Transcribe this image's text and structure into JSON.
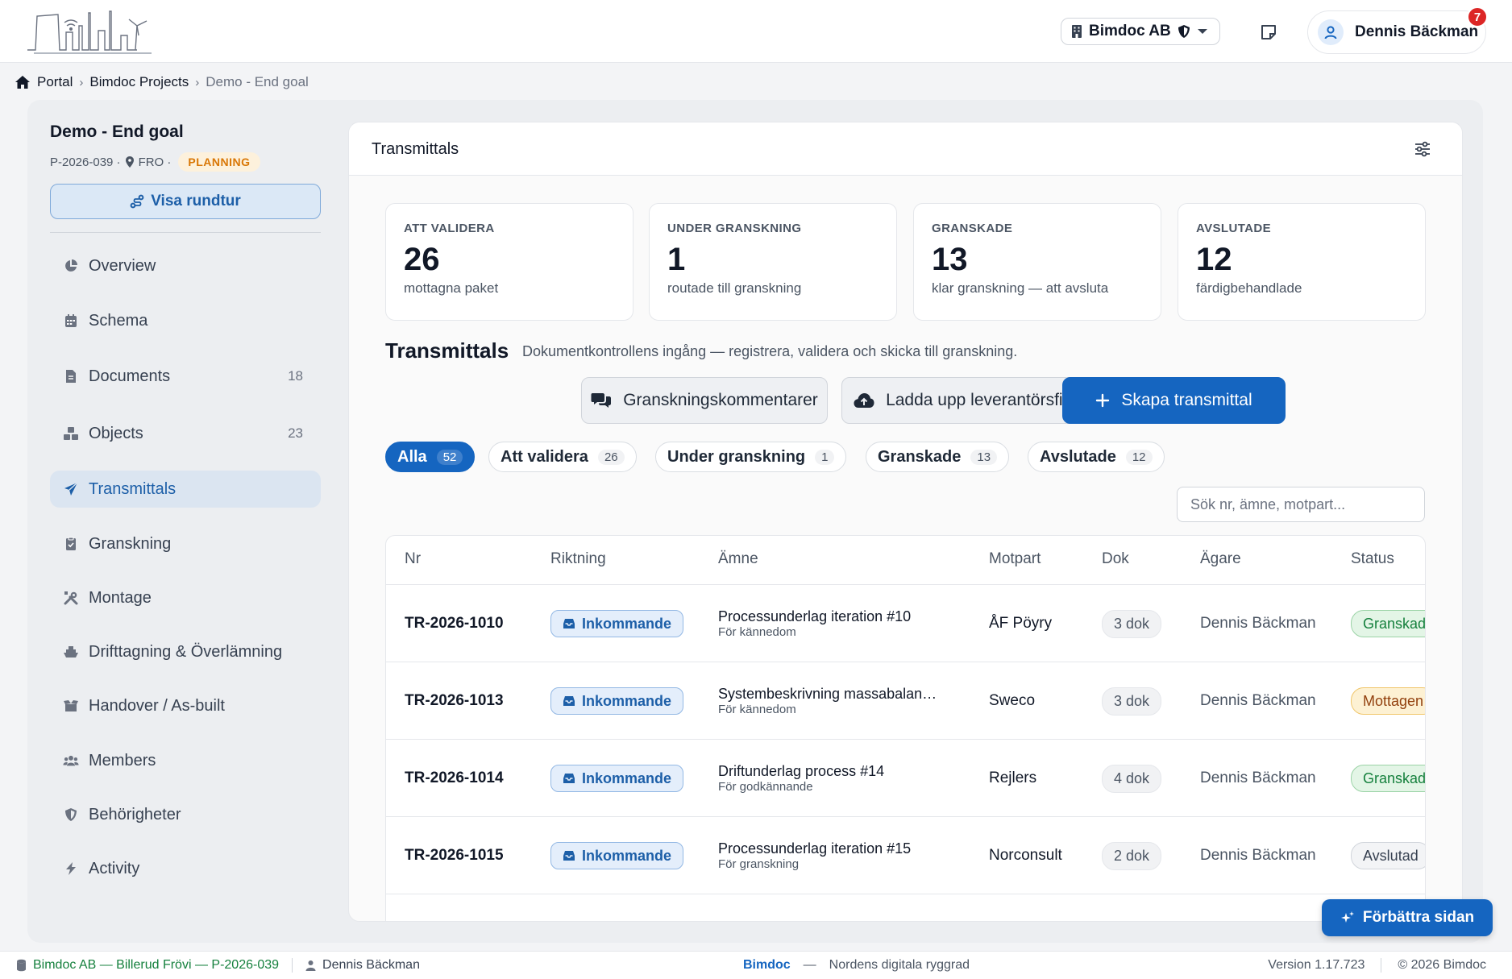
{
  "colors": {
    "primary": "#1565c0",
    "planning_badge": "#d97706",
    "footer_project": "#15803d",
    "notification": "#dc2626"
  },
  "header": {
    "logo_icon": "city-skyline-logo",
    "company": "Bimdoc AB",
    "user_name": "Dennis Bäckman",
    "notification_count": "7"
  },
  "breadcrumb": {
    "items": [
      "Portal",
      "Bimdoc Projects"
    ],
    "current": "Demo - End goal"
  },
  "project": {
    "title": "Demo - End goal",
    "code": "P-2026-039 ·",
    "location": "FRO ·",
    "phase": "PLANNING",
    "tour_button": "Visa rundtur"
  },
  "sidebar": {
    "items": [
      {
        "label": "Overview",
        "icon": "chart-pie-icon",
        "count": ""
      },
      {
        "label": "Schema",
        "icon": "calendar-icon",
        "count": ""
      },
      {
        "label": "Documents",
        "icon": "file-icon",
        "count": "18"
      },
      {
        "label": "Objects",
        "icon": "cubes-icon",
        "count": "23"
      },
      {
        "label": "Transmittals",
        "icon": "paper-plane-icon",
        "count": ""
      },
      {
        "label": "Granskning",
        "icon": "clipboard-check-icon",
        "count": ""
      },
      {
        "label": "Montage",
        "icon": "tools-icon",
        "count": ""
      },
      {
        "label": "Drifttagning & Överlämning",
        "icon": "ship-icon",
        "count": ""
      },
      {
        "label": "Handover / As-built",
        "icon": "box-open-icon",
        "count": ""
      },
      {
        "label": "Members",
        "icon": "users-icon",
        "count": ""
      },
      {
        "label": "Behörigheter",
        "icon": "shield-icon",
        "count": ""
      },
      {
        "label": "Activity",
        "icon": "bolt-icon",
        "count": ""
      }
    ],
    "active_index": 4
  },
  "main": {
    "panel_title": "Transmittals",
    "stats": [
      {
        "label": "ATT VALIDERA",
        "value": "26",
        "desc": "mottagna paket"
      },
      {
        "label": "UNDER GRANSKNING",
        "value": "1",
        "desc": "routade till granskning"
      },
      {
        "label": "GRANSKADE",
        "value": "13",
        "desc": "klar granskning — att avsluta"
      },
      {
        "label": "AVSLUTADE",
        "value": "12",
        "desc": "färdigbehandlade"
      }
    ],
    "section_title": "Transmittals",
    "section_desc": "Dokumentkontrollens ingång — registrera, validera och skicka till granskning.",
    "buttons": {
      "comments": "Granskningskommentarer",
      "upload": "Ladda upp leverantörsfiler",
      "create": "Skapa transmittal"
    },
    "filters": [
      {
        "label": "Alla",
        "count": "52"
      },
      {
        "label": "Att validera",
        "count": "26"
      },
      {
        "label": "Under granskning",
        "count": "1"
      },
      {
        "label": "Granskade",
        "count": "13"
      },
      {
        "label": "Avslutade",
        "count": "12"
      }
    ],
    "search_placeholder": "Sök nr, ämne, motpart...",
    "table": {
      "columns": [
        "Nr",
        "Riktning",
        "Ämne",
        "Motpart",
        "Dok",
        "Ägare",
        "Status"
      ],
      "rows": [
        {
          "nr": "TR-2026-1010",
          "direction": "Inkommande",
          "subject": "Processunderlag iteration #10",
          "purpose": "För kännedom",
          "party": "ÅF Pöyry",
          "docs": "3 dok",
          "owner": "Dennis Bäckman",
          "status": "Granskad"
        },
        {
          "nr": "TR-2026-1013",
          "direction": "Inkommande",
          "subject": "Systembeskrivning massabalan…",
          "purpose": "För kännedom",
          "party": "Sweco",
          "docs": "3 dok",
          "owner": "Dennis Bäckman",
          "status": "Mottagen"
        },
        {
          "nr": "TR-2026-1014",
          "direction": "Inkommande",
          "subject": "Driftunderlag process #14",
          "purpose": "För godkännande",
          "party": "Rejlers",
          "docs": "4 dok",
          "owner": "Dennis Bäckman",
          "status": "Granskad"
        },
        {
          "nr": "TR-2026-1015",
          "direction": "Inkommande",
          "subject": "Processunderlag iteration #15",
          "purpose": "För granskning",
          "party": "Norconsult",
          "docs": "2 dok",
          "owner": "Dennis Bäckman",
          "status": "Avslutad"
        }
      ]
    }
  },
  "improve_button": "Förbättra sidan",
  "footer": {
    "project": "Bimdoc AB — Billerud Frövi — P-2026-039",
    "user": "Dennis Bäckman",
    "brand": "Bimdoc",
    "dash": "—",
    "tagline": "Nordens digitala ryggrad",
    "version": "Version 1.17.723",
    "copyright": "© 2026 Bimdoc"
  }
}
